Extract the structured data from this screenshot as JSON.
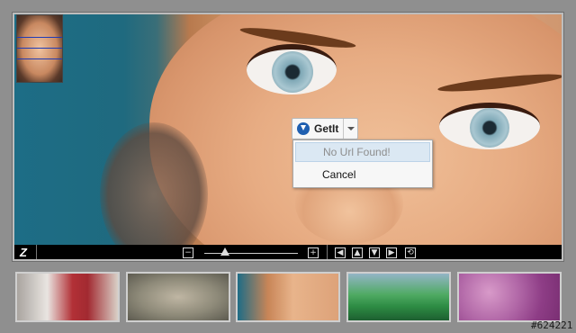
{
  "viewer": {
    "zoom_out": "−",
    "zoom_in": "+",
    "nav_left": "◀",
    "nav_up": "▲",
    "nav_down": "▼",
    "nav_right": "▶",
    "reset": "⟲",
    "logo_text": "Z",
    "zoom_level": 0.22
  },
  "getit_button": {
    "label": "GetIt",
    "icon": "download-icon"
  },
  "context_menu": {
    "items": [
      {
        "label": "No Url Found!",
        "disabled": true
      },
      {
        "label": "Cancel",
        "disabled": false
      }
    ]
  },
  "thumbnails": [
    {
      "subject": "venetian-mask"
    },
    {
      "subject": "banknote-portrait"
    },
    {
      "subject": "woman-eyes"
    },
    {
      "subject": "green-car"
    },
    {
      "subject": "pink-tissue-micrograph"
    }
  ],
  "watermark": "#624221",
  "colors": {
    "menu_highlight": "#dbe8f3",
    "getit_icon": "#1f5fb0"
  }
}
